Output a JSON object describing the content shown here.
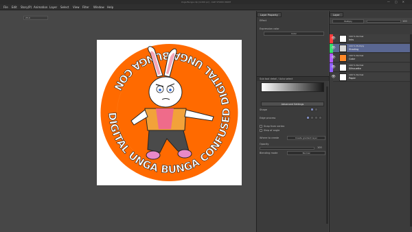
{
  "window": {
    "title": "Unga Bunga.clip [4,000 px] - CLIP STUDIO PAINT",
    "controls": [
      "—",
      "□",
      "✕"
    ]
  },
  "menu": [
    "File",
    "Edit",
    "Story(P)",
    "Animation",
    "Layer",
    "Select",
    "View",
    "Filter",
    "Window",
    "Help"
  ],
  "canvas": {
    "zoom": "25.0",
    "artwork": {
      "badge_color": "#ff6a00",
      "ring_text": "DIGITAL UNGA BUNGA CONFUSED DIGITAL UNGA BUNGA CON"
    }
  },
  "prop_panel": {
    "tabs": [
      "Layer Property",
      "Tool property"
    ],
    "effect_label": "Effect",
    "expression_label": "Expression color",
    "expression_value": "Color",
    "subtool_title": "Sub tool detail / Auto select",
    "advanced_button": "Advanced Settings",
    "shape_label": "Shape",
    "edge_label": "Edge process",
    "snap_label": "Snap from vertex",
    "step_label": "Step of angle",
    "where_label": "Where to create",
    "where_value": "Create gradient layer",
    "opacity_label": "Opacity",
    "opacity_value": "100",
    "blend_label": "Blending mode",
    "blend_value": "Normal"
  },
  "layer_panel": {
    "tabs": [
      "Layer"
    ],
    "blend_mode": "Multiply",
    "opacity": "100",
    "layers": [
      {
        "sub": "100 % Normal",
        "name": "Inks",
        "color": "#ff3b3b",
        "thumb": "#ffffff",
        "selected": false
      },
      {
        "sub": "100 % Multiply",
        "name": "Shading",
        "color": "#35e06a",
        "thumb": "#d8d8d8",
        "selected": true
      },
      {
        "sub": "100 % Normal",
        "name": "Color",
        "color": "#b05cff",
        "thumb": "#ff8a2a",
        "selected": false
      },
      {
        "sub": "100 % Normal",
        "name": "Silhouette",
        "color": "#8e5cff",
        "thumb": "#ffffff",
        "selected": false
      },
      {
        "sub": "100 % Normal",
        "name": "Paper",
        "color": "#3b3b3b",
        "thumb": "#ffffff",
        "selected": false
      }
    ]
  }
}
